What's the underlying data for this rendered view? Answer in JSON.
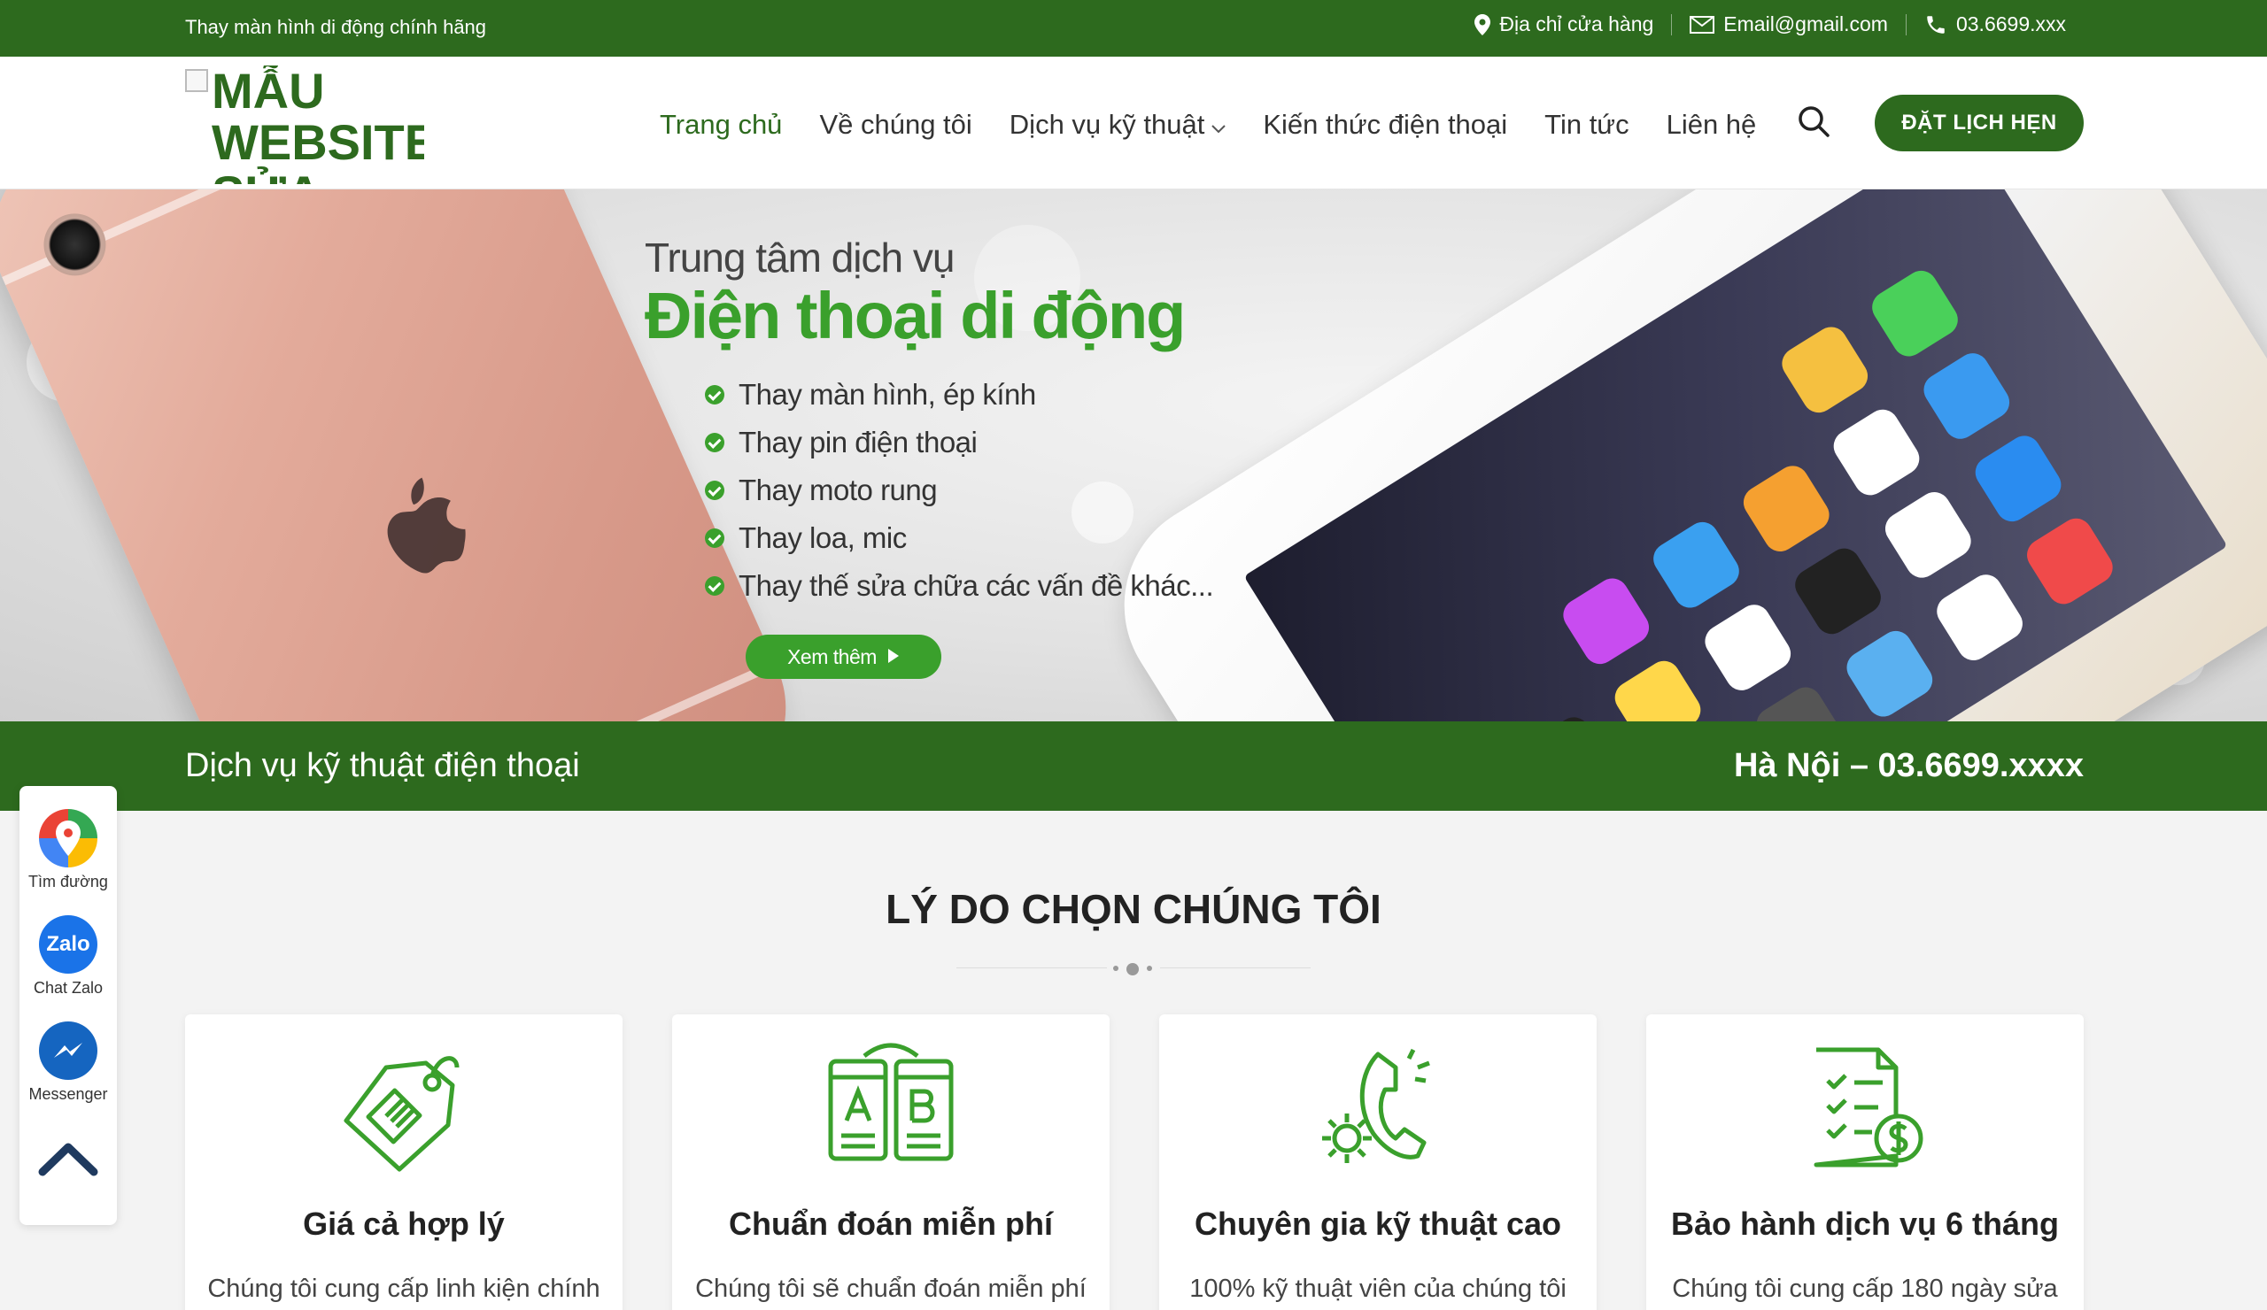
{
  "topbar": {
    "tagline": "Thay màn hình di động chính hãng",
    "address": "Địa chỉ cửa hàng",
    "email": "Email@gmail.com",
    "phone": "03.6699.xxx"
  },
  "header": {
    "logo_alt": "MẪU WEBSITE SỬA MÀN",
    "nav": [
      "Trang chủ",
      "Về chúng tôi",
      "Dịch vụ kỹ thuật",
      "Kiến thức điện thoại",
      "Tin tức",
      "Liên hệ"
    ],
    "book_label": "ĐẶT LỊCH HẸN"
  },
  "banner": {
    "title": "Trung tâm dịch vụ",
    "title_big": "Điện thoại di động",
    "features": [
      "Thay màn hình, ép kính",
      "Thay pin điện thoại",
      "Thay moto rung",
      "Thay loa, mic",
      "Thay thế sửa chữa các vấn đề khác..."
    ],
    "more_label": "Xem thêm"
  },
  "strip": {
    "left": "Dịch vụ kỹ thuật điện thoại",
    "right": "Hà Nội – 03.6699.xxxx"
  },
  "section": {
    "title": "LÝ DO CHỌN CHÚNG TÔI",
    "cards": [
      {
        "title": "Giá cả hợp lý",
        "desc": "Chúng tôi cung cấp linh kiện chính"
      },
      {
        "title": "Chuẩn đoán miễn phí",
        "desc": "Chúng tôi sẽ chuẩn đoán miễn phí"
      },
      {
        "title": "Chuyên gia kỹ thuật cao",
        "desc": "100% kỹ thuật viên của chúng tôi"
      },
      {
        "title": "Bảo hành dịch vụ 6 tháng",
        "desc": "Chúng tôi cung cấp 180 ngày sửa"
      }
    ]
  },
  "side": {
    "maps": "Tìm đường",
    "zalo": "Chat Zalo",
    "zalo_icon_text": "Zalo",
    "messenger": "Messenger"
  },
  "colors": {
    "brand_green": "#2d6a1e",
    "accent_green": "#3aa02c"
  }
}
